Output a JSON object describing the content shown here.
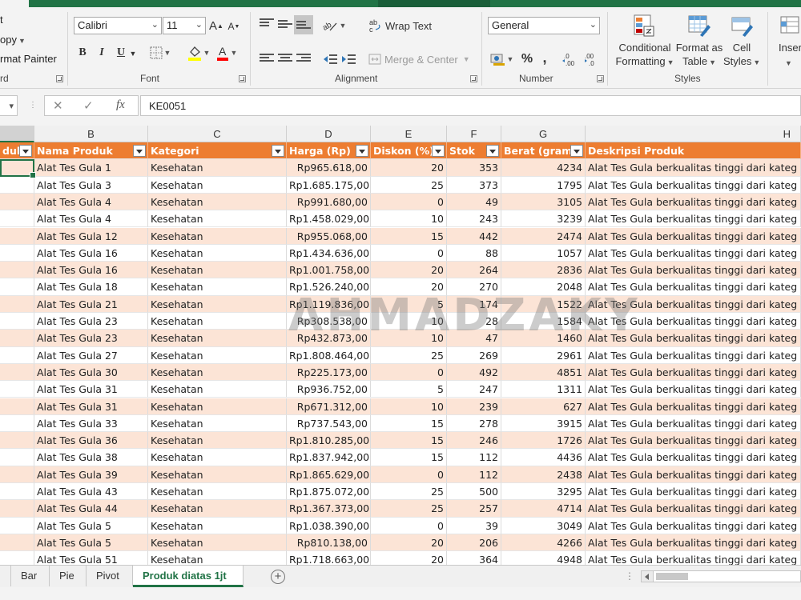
{
  "ribbon": {
    "clipboard": {
      "cut": "t",
      "copy": "opy",
      "format_painter": "rmat Painter",
      "group": "rd"
    },
    "font": {
      "name": "Calibri",
      "size": "11",
      "grow": "A",
      "shrink": "A",
      "bold": "B",
      "italic": "I",
      "underline": "U",
      "group": "Font",
      "fill_color": "#ffff00",
      "font_color": "#ff0000"
    },
    "alignment": {
      "wrap_text": "Wrap Text",
      "merge_center": "Merge & Center",
      "group": "Alignment"
    },
    "number": {
      "format": "General",
      "percent": "%",
      "comma": ",",
      "inc_decimal": ".00",
      "dec_decimal": ".0",
      "group": "Number"
    },
    "styles": {
      "conditional_1": "Conditional",
      "conditional_2": "Formatting",
      "format_table_1": "Format as",
      "format_table_2": "Table",
      "cell_styles_1": "Cell",
      "cell_styles_2": "Styles",
      "group": "Styles"
    },
    "insert": "Inser"
  },
  "formula_bar": {
    "cancel": "✕",
    "enter": "✓",
    "fx": "fx",
    "value": "KE0051"
  },
  "columns": [
    "B",
    "C",
    "D",
    "E",
    "F",
    "G",
    "H"
  ],
  "table": {
    "headers": [
      "duk",
      "Nama Produk",
      "Kategori",
      "Harga (Rp)",
      "Diskon (%)",
      "Stok",
      "Berat (gram)",
      "Deskripsi Produk"
    ],
    "rows": [
      [
        "Alat Tes Gula 1",
        "Kesehatan",
        "Rp965.618,00",
        "20",
        "353",
        "4234",
        "Alat Tes Gula berkualitas tinggi dari kateg"
      ],
      [
        "Alat Tes Gula 3",
        "Kesehatan",
        "Rp1.685.175,00",
        "25",
        "373",
        "1795",
        "Alat Tes Gula berkualitas tinggi dari kateg"
      ],
      [
        "Alat Tes Gula 4",
        "Kesehatan",
        "Rp991.680,00",
        "0",
        "49",
        "3105",
        "Alat Tes Gula berkualitas tinggi dari kateg"
      ],
      [
        "Alat Tes Gula 4",
        "Kesehatan",
        "Rp1.458.029,00",
        "10",
        "243",
        "3239",
        "Alat Tes Gula berkualitas tinggi dari kateg"
      ],
      [
        "Alat Tes Gula 12",
        "Kesehatan",
        "Rp955.068,00",
        "15",
        "442",
        "2474",
        "Alat Tes Gula berkualitas tinggi dari kateg"
      ],
      [
        "Alat Tes Gula 16",
        "Kesehatan",
        "Rp1.434.636,00",
        "0",
        "88",
        "1057",
        "Alat Tes Gula berkualitas tinggi dari kateg"
      ],
      [
        "Alat Tes Gula 16",
        "Kesehatan",
        "Rp1.001.758,00",
        "20",
        "264",
        "2836",
        "Alat Tes Gula berkualitas tinggi dari kateg"
      ],
      [
        "Alat Tes Gula 18",
        "Kesehatan",
        "Rp1.526.240,00",
        "20",
        "270",
        "2048",
        "Alat Tes Gula berkualitas tinggi dari kateg"
      ],
      [
        "Alat Tes Gula 21",
        "Kesehatan",
        "Rp1.119.836,00",
        "5",
        "174",
        "1522",
        "Alat Tes Gula berkualitas tinggi dari kateg"
      ],
      [
        "Alat Tes Gula 23",
        "Kesehatan",
        "Rp308.538,00",
        "10",
        "28",
        "1584",
        "Alat Tes Gula berkualitas tinggi dari kateg"
      ],
      [
        "Alat Tes Gula 23",
        "Kesehatan",
        "Rp432.873,00",
        "10",
        "47",
        "1460",
        "Alat Tes Gula berkualitas tinggi dari kateg"
      ],
      [
        "Alat Tes Gula 27",
        "Kesehatan",
        "Rp1.808.464,00",
        "25",
        "269",
        "2961",
        "Alat Tes Gula berkualitas tinggi dari kateg"
      ],
      [
        "Alat Tes Gula 30",
        "Kesehatan",
        "Rp225.173,00",
        "0",
        "492",
        "4851",
        "Alat Tes Gula berkualitas tinggi dari kateg"
      ],
      [
        "Alat Tes Gula 31",
        "Kesehatan",
        "Rp936.752,00",
        "5",
        "247",
        "1311",
        "Alat Tes Gula berkualitas tinggi dari kateg"
      ],
      [
        "Alat Tes Gula 31",
        "Kesehatan",
        "Rp671.312,00",
        "10",
        "239",
        "627",
        "Alat Tes Gula berkualitas tinggi dari kateg"
      ],
      [
        "Alat Tes Gula 33",
        "Kesehatan",
        "Rp737.543,00",
        "15",
        "278",
        "3915",
        "Alat Tes Gula berkualitas tinggi dari kateg"
      ],
      [
        "Alat Tes Gula 36",
        "Kesehatan",
        "Rp1.810.285,00",
        "15",
        "246",
        "1726",
        "Alat Tes Gula berkualitas tinggi dari kateg"
      ],
      [
        "Alat Tes Gula 38",
        "Kesehatan",
        "Rp1.837.942,00",
        "15",
        "112",
        "4436",
        "Alat Tes Gula berkualitas tinggi dari kateg"
      ],
      [
        "Alat Tes Gula 39",
        "Kesehatan",
        "Rp1.865.629,00",
        "0",
        "112",
        "2438",
        "Alat Tes Gula berkualitas tinggi dari kateg"
      ],
      [
        "Alat Tes Gula 43",
        "Kesehatan",
        "Rp1.875.072,00",
        "25",
        "500",
        "3295",
        "Alat Tes Gula berkualitas tinggi dari kateg"
      ],
      [
        "Alat Tes Gula 44",
        "Kesehatan",
        "Rp1.367.373,00",
        "25",
        "257",
        "4714",
        "Alat Tes Gula berkualitas tinggi dari kateg"
      ],
      [
        "Alat Tes Gula 5",
        "Kesehatan",
        "Rp1.038.390,00",
        "0",
        "39",
        "3049",
        "Alat Tes Gula berkualitas tinggi dari kateg"
      ],
      [
        "Alat Tes Gula 5",
        "Kesehatan",
        "Rp810.138,00",
        "20",
        "206",
        "4266",
        "Alat Tes Gula berkualitas tinggi dari kateg"
      ],
      [
        "Alat Tes Gula 51",
        "Kesehatan",
        "Rp1.718.663,00",
        "20",
        "364",
        "4948",
        "Alat Tes Gula berkualitas tinggi dari kateg"
      ]
    ]
  },
  "watermark": "AHMADZAKY",
  "sheet_tabs": [
    "Bar",
    "Pie",
    "Pivot",
    "Produk diatas 1jt"
  ],
  "colors": {
    "accent": "#217346",
    "header_fill": "#ed7d31",
    "band_fill": "#fce4d6"
  }
}
